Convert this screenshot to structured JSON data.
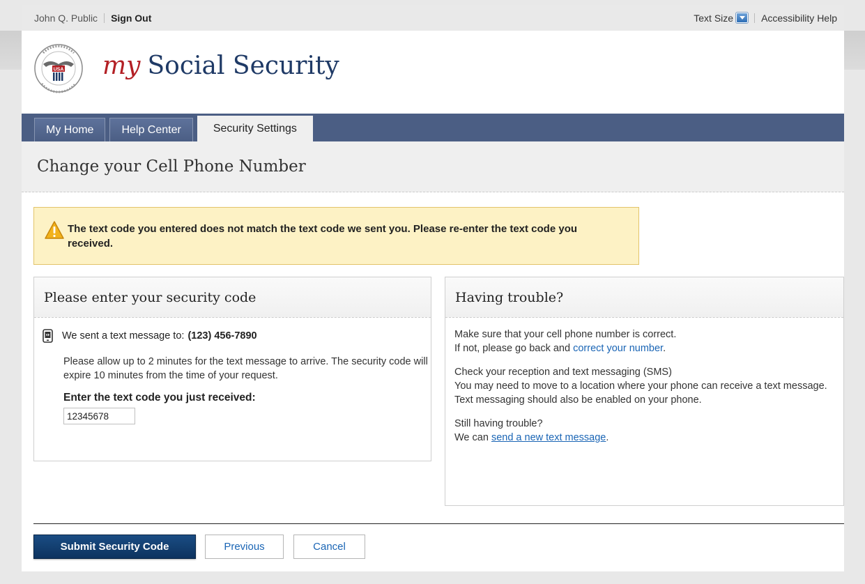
{
  "topbar": {
    "user_name": "John Q. Public",
    "sign_out": "Sign Out",
    "text_size": "Text Size",
    "accessibility_help": "Accessibility Help"
  },
  "header": {
    "brand_my": "my",
    "brand_rest": "Social Security",
    "seal_text": "SOCIAL SECURITY ADMINISTRATION USA"
  },
  "nav": {
    "tabs": [
      {
        "label": "My Home",
        "active": false
      },
      {
        "label": "Help Center",
        "active": false
      },
      {
        "label": "Security Settings",
        "active": true
      }
    ]
  },
  "page_title": "Change your Cell Phone Number",
  "alert": {
    "message": "The text code you entered does not match the text code we sent you. Please re-enter the text code you received."
  },
  "security_panel": {
    "heading": "Please enter your security code",
    "sent_prefix": "We sent a text message to:",
    "phone_number": "(123) 456-7890",
    "note": "Please allow up to 2 minutes for the text message to arrive. The security code will expire 10 minutes from the time of your request.",
    "input_label": "Enter the text code you just received:",
    "input_value": "12345678"
  },
  "trouble_panel": {
    "heading": "Having trouble?",
    "p1_line1": "Make sure that your cell phone number is correct.",
    "p1_line2_prefix": "If not, please go back and",
    "p1_link": "correct your number",
    "p2_title": "Check your reception and text messaging (SMS)",
    "p2_body": "You may need to move to a location where your phone can receive a text message. Text messaging should also be enabled on your phone.",
    "p3_title": "Still having trouble?",
    "p3_prefix": "We can",
    "p3_link": "send a new text message"
  },
  "buttons": {
    "submit": "Submit Security Code",
    "previous": "Previous",
    "cancel": "Cancel"
  },
  "colors": {
    "nav_bg": "#4b5e84",
    "brand_red": "#b31f24",
    "brand_navy": "#1f3a66",
    "link": "#1a65b5",
    "alert_bg": "#fdf2c5",
    "primary_button": "#0d335f"
  }
}
